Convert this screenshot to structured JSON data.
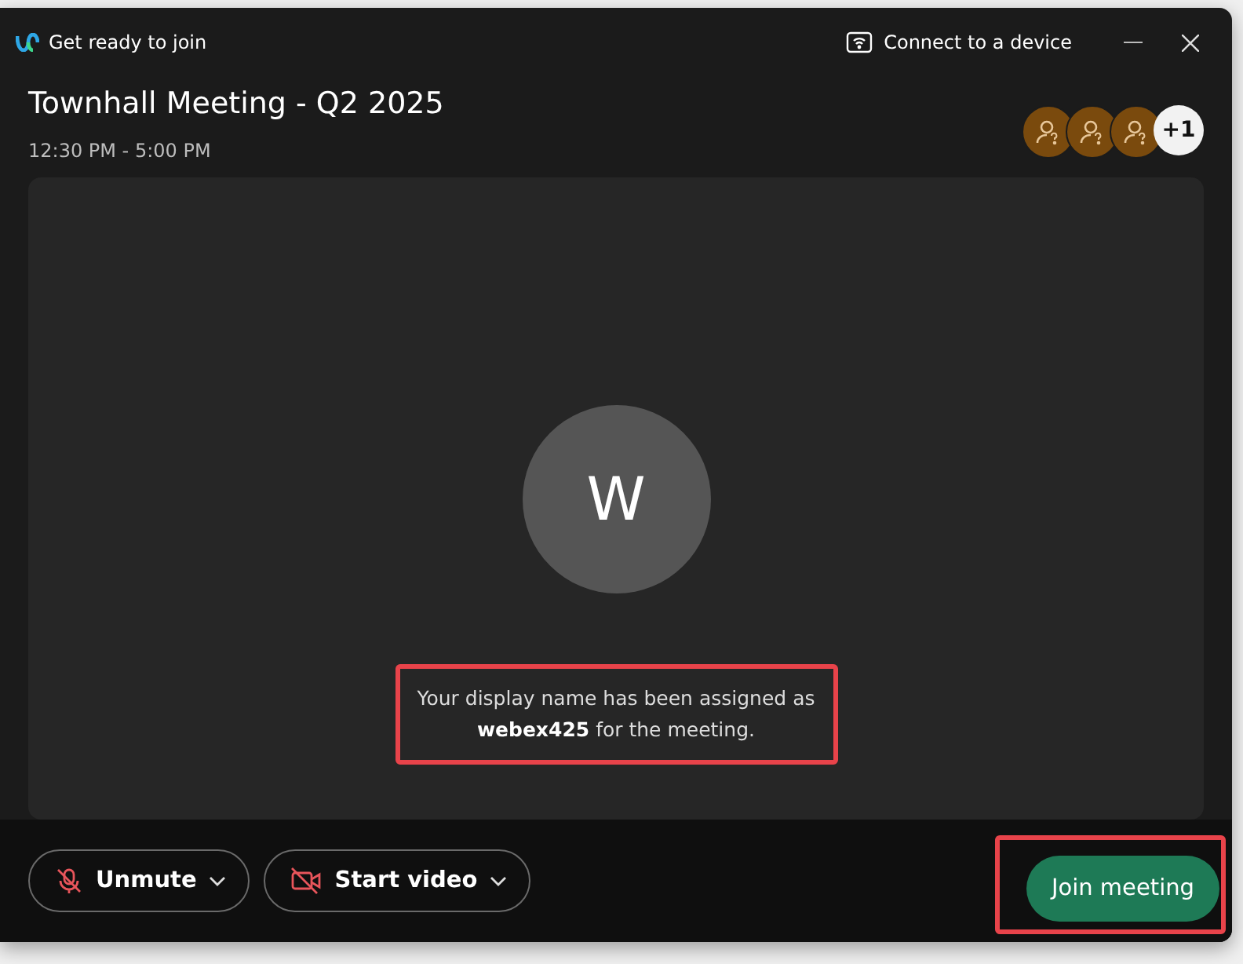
{
  "window": {
    "title": "Get ready to join",
    "connect_label": "Connect to a device"
  },
  "meeting": {
    "title": "Townhall Meeting - Q2 2025",
    "time": "12:30 PM - 5:00 PM"
  },
  "participants": {
    "avatars": [
      {
        "kind": "guest"
      },
      {
        "kind": "guest"
      },
      {
        "kind": "guest"
      }
    ],
    "more": "+1"
  },
  "preview": {
    "initial": "W",
    "message": "Your display name has been assigned as\n**webex425** for the meeting.",
    "highlighted": true
  },
  "controls": [
    {
      "label": "Unmute",
      "kind": "mic",
      "muted": true
    },
    {
      "label": "Start video",
      "kind": "video",
      "muted": true
    }
  ],
  "join": {
    "label": "Join meeting",
    "highlighted": true
  }
}
